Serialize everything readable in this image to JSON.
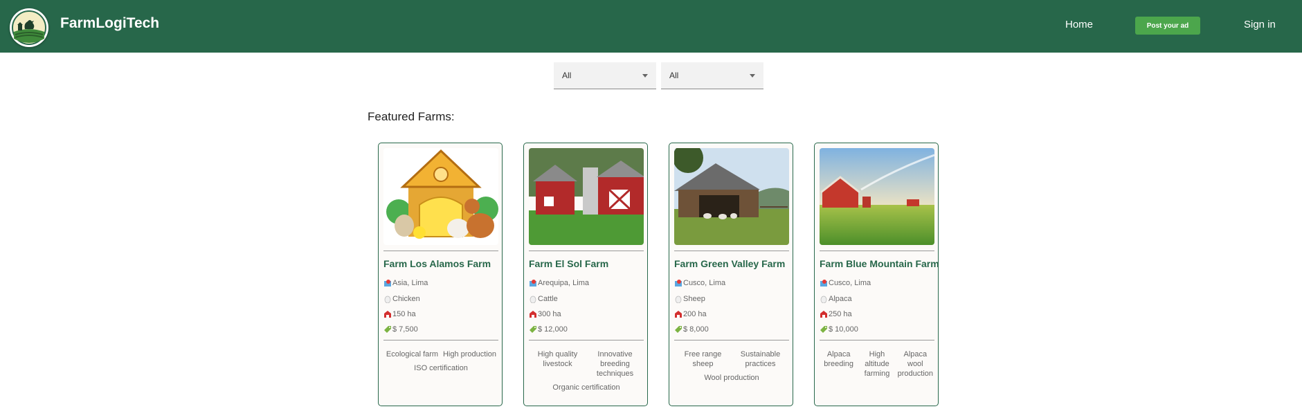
{
  "header": {
    "brand": "FarmLogiTech",
    "nav": {
      "home": "Home",
      "post_ad": "Post your ad",
      "sign_in": "Sign in"
    }
  },
  "filters": [
    {
      "value": "All"
    },
    {
      "value": "All"
    }
  ],
  "section_title": "Featured Farms:",
  "farms": [
    {
      "name": "Farm Los Alamos Farm",
      "location": "Asia, Lima",
      "animal": "Chicken",
      "area": "150 ha",
      "price": "$ 7,500",
      "features": [
        "Ecological farm",
        "High production",
        "ISO certification"
      ]
    },
    {
      "name": "Farm El Sol Farm",
      "location": "Arequipa, Lima",
      "animal": "Cattle",
      "area": "300 ha",
      "price": "$ 12,000",
      "features": [
        "High quality livestock",
        "Innovative breeding techniques",
        "Organic certification"
      ]
    },
    {
      "name": "Farm Green Valley Farm",
      "location": "Cusco, Lima",
      "animal": "Sheep",
      "area": "200 ha",
      "price": "$ 8,000",
      "features": [
        "Free range sheep",
        "Sustainable practices",
        "Wool production"
      ]
    },
    {
      "name": "Farm Blue Mountain Farm",
      "location": "Cusco, Lima",
      "animal": "Alpaca",
      "area": "250 ha",
      "price": "$ 10,000",
      "features": [
        "Alpaca breeding",
        "High altitude farming",
        "Alpaca wool production"
      ]
    }
  ]
}
